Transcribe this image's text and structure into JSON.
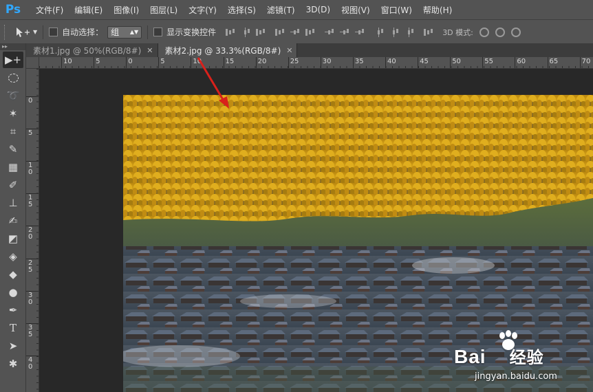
{
  "app": {
    "logo": "Ps"
  },
  "menu": [
    "文件(F)",
    "编辑(E)",
    "图像(I)",
    "图层(L)",
    "文字(Y)",
    "选择(S)",
    "滤镜(T)",
    "3D(D)",
    "视图(V)",
    "窗口(W)",
    "帮助(H)"
  ],
  "options": {
    "auto_select_label": "自动选择：",
    "auto_select_value": "组",
    "show_transform_label": "显示变换控件",
    "mode_3d_label": "3D 模式:"
  },
  "tabs": [
    {
      "label": "素材1.jpg @ 50%(RGB/8#)",
      "active": false
    },
    {
      "label": "素材2.jpg @ 33.3%(RGB/8#)",
      "active": true
    }
  ],
  "ruler_h": [
    "10",
    "5",
    "0",
    "5",
    "10",
    "15",
    "20",
    "25",
    "30",
    "35",
    "40",
    "45",
    "50",
    "55",
    "60",
    "65",
    "70"
  ],
  "ruler_v": [
    "0",
    "5",
    "10",
    "15",
    "20",
    "25",
    "30",
    "35",
    "40"
  ],
  "tools": [
    "move-tool",
    "marquee-tool",
    "lasso-tool",
    "magic-wand-tool",
    "crop-tool",
    "eyedropper-tool",
    "healing-tool",
    "brush-tool",
    "stamp-tool",
    "history-brush-tool",
    "eraser-tool",
    "bucket-tool",
    "blur-tool",
    "dodge-tool",
    "pen-tool",
    "type-tool",
    "path-select-tool",
    "shape-tool"
  ],
  "watermark": {
    "brand": "Bai",
    "brand_cn": "经验",
    "url": "jingyan.baidu.com"
  },
  "colors": {
    "menubar": "#535353",
    "workspace": "#282828",
    "accent_logo": "#31a8ff",
    "arrow": "#d9211b"
  }
}
